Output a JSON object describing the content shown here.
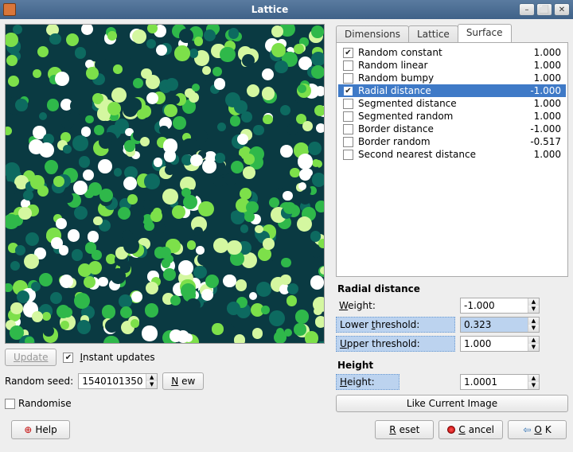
{
  "window": {
    "title": "Lattice"
  },
  "left": {
    "update": "Update",
    "instant": "Instant updates",
    "instant_checked": true,
    "seed_label": "Random seed:",
    "seed_value": "1540101350",
    "new": "New",
    "randomise": "Randomise",
    "randomise_checked": false,
    "help": "Help"
  },
  "tabs": {
    "t0": "Dimensions",
    "t1": "Lattice",
    "t2": "Surface",
    "active": 2
  },
  "surface_items": [
    {
      "label": "Random constant",
      "value": "1.000",
      "checked": true
    },
    {
      "label": "Random linear",
      "value": "1.000",
      "checked": false
    },
    {
      "label": "Random bumpy",
      "value": "1.000",
      "checked": false
    },
    {
      "label": "Radial distance",
      "value": "-1.000",
      "checked": true,
      "selected": true
    },
    {
      "label": "Segmented distance",
      "value": "1.000",
      "checked": false
    },
    {
      "label": "Segmented random",
      "value": "1.000",
      "checked": false
    },
    {
      "label": "Border distance",
      "value": "-1.000",
      "checked": false
    },
    {
      "label": "Border random",
      "value": "-0.517",
      "checked": false
    },
    {
      "label": "Second nearest distance",
      "value": "1.000",
      "checked": false
    }
  ],
  "props": {
    "radial_header": "Radial distance",
    "weight_label": "Weight:",
    "weight_value": "-1.000",
    "lower_label": "Lower threshold:",
    "lower_value": "0.323",
    "upper_label": "Upper threshold:",
    "upper_value": "1.000",
    "height_header": "Height",
    "height_label": "Height:",
    "height_value": "1.0001",
    "like": "Like Current Image"
  },
  "buttons": {
    "reset": "Reset",
    "cancel": "Cancel",
    "ok": "OK"
  }
}
